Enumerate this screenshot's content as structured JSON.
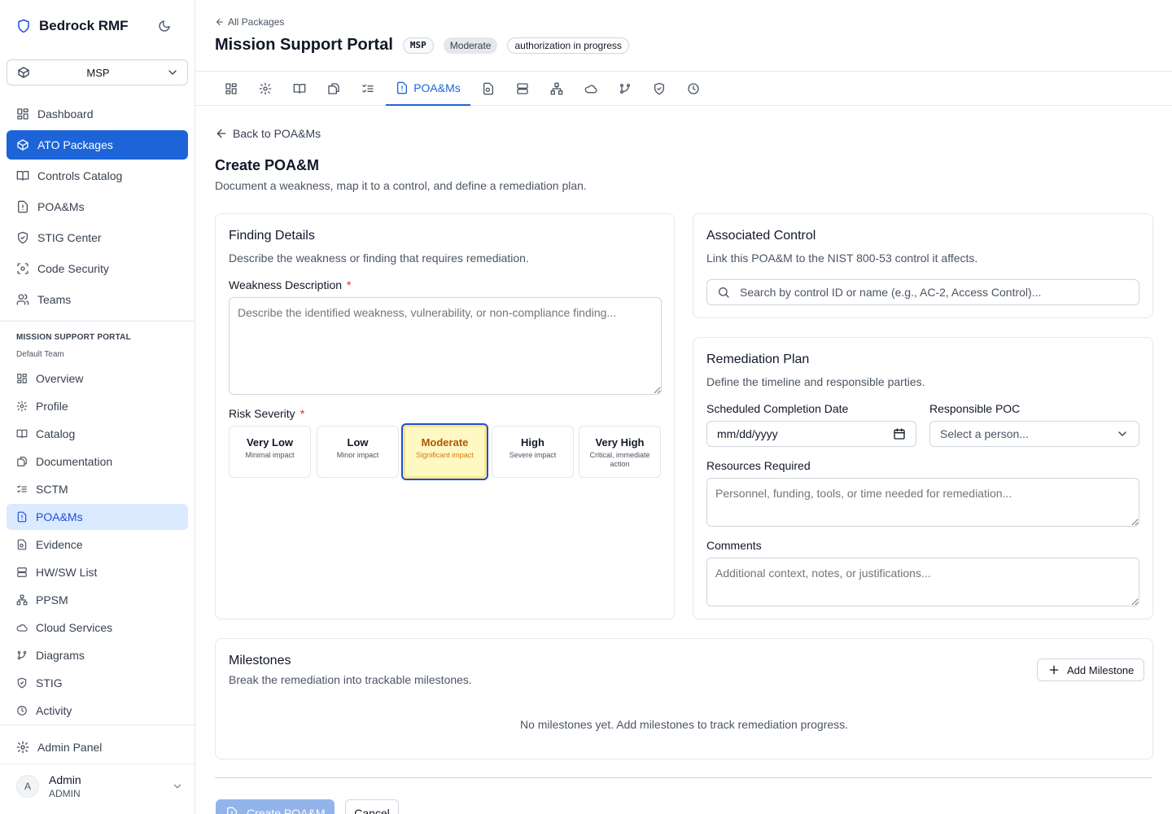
{
  "app": {
    "name": "Bedrock RMF"
  },
  "package_select": {
    "value": "MSP"
  },
  "nav": {
    "items": [
      {
        "label": "Dashboard",
        "icon": "dashboard-icon"
      },
      {
        "label": "ATO Packages",
        "icon": "package-icon",
        "active": true
      },
      {
        "label": "Controls Catalog",
        "icon": "book-icon"
      },
      {
        "label": "POA&Ms",
        "icon": "file-alert-icon"
      },
      {
        "label": "STIG Center",
        "icon": "shield-check-icon"
      },
      {
        "label": "Code Security",
        "icon": "scan-icon"
      },
      {
        "label": "Teams",
        "icon": "users-icon"
      }
    ]
  },
  "package_section": {
    "title": "MISSION SUPPORT PORTAL",
    "subtitle": "Default Team",
    "items": [
      {
        "label": "Overview"
      },
      {
        "label": "Profile"
      },
      {
        "label": "Catalog"
      },
      {
        "label": "Documentation"
      },
      {
        "label": "SCTM"
      },
      {
        "label": "POA&Ms",
        "active": true
      },
      {
        "label": "Evidence"
      },
      {
        "label": "HW/SW List"
      },
      {
        "label": "PPSM"
      },
      {
        "label": "Cloud Services"
      },
      {
        "label": "Diagrams"
      },
      {
        "label": "STIG"
      },
      {
        "label": "Activity"
      }
    ]
  },
  "admin_panel": {
    "label": "Admin Panel"
  },
  "user": {
    "initial": "A",
    "name": "Admin",
    "role": "ADMIN"
  },
  "header": {
    "breadcrumb": "All Packages",
    "title": "Mission Support Portal",
    "badges": {
      "code": "MSP",
      "impact": "Moderate",
      "status": "authorization in progress"
    }
  },
  "tabs": {
    "active_label": "POA&Ms"
  },
  "page": {
    "back_label": "Back to POA&Ms",
    "title": "Create POA&M",
    "description": "Document a weakness, map it to a control, and define a remediation plan."
  },
  "finding": {
    "title": "Finding Details",
    "subtitle": "Describe the weakness or finding that requires remediation.",
    "weakness_label": "Weakness Description",
    "weakness_placeholder": "Describe the identified weakness, vulnerability, or non-compliance finding...",
    "severity_label": "Risk Severity",
    "required_mark": "*",
    "severities": [
      {
        "name": "Very Low",
        "desc": "Minimal impact"
      },
      {
        "name": "Low",
        "desc": "Minor impact"
      },
      {
        "name": "Moderate",
        "desc": "Significant impact",
        "selected": true
      },
      {
        "name": "High",
        "desc": "Severe impact"
      },
      {
        "name": "Very High",
        "desc": "Critical, immediate action"
      }
    ]
  },
  "control": {
    "title": "Associated Control",
    "subtitle": "Link this POA&M to the NIST 800-53 control it affects.",
    "search_placeholder": "Search by control ID or name (e.g., AC-2, Access Control)..."
  },
  "remediation": {
    "title": "Remediation Plan",
    "subtitle": "Define the timeline and responsible parties.",
    "date_label": "Scheduled Completion Date",
    "date_placeholder": "mm/dd/yyyy",
    "poc_label": "Responsible POC",
    "poc_placeholder": "Select a person...",
    "resources_label": "Resources Required",
    "resources_placeholder": "Personnel, funding, tools, or time needed for remediation...",
    "comments_label": "Comments",
    "comments_placeholder": "Additional context, notes, or justifications..."
  },
  "milestones": {
    "title": "Milestones",
    "subtitle": "Break the remediation into trackable milestones.",
    "add_label": "Add Milestone",
    "empty_text": "No milestones yet. Add milestones to track remediation progress."
  },
  "actions": {
    "create_label": "Create POA&M",
    "cancel_label": "Cancel"
  },
  "colors": {
    "accent": "#1d64d8",
    "required": "#dc2626",
    "moderate_bg": "#fef9c3",
    "moderate_text": "#b45309"
  }
}
